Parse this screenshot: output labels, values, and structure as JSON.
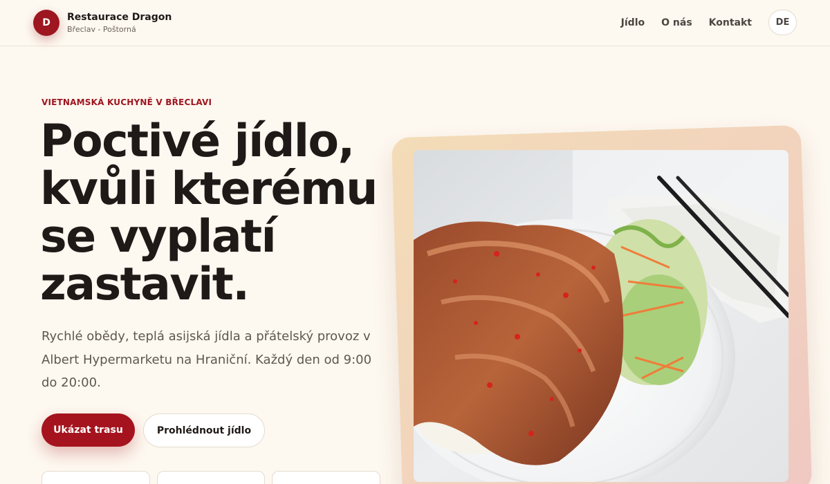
{
  "header": {
    "logo_letter": "D",
    "brand_name": "Restaurace Dragon",
    "brand_location": "Břeclav - Poštorná",
    "nav": [
      {
        "label": "Jídlo"
      },
      {
        "label": "O nás"
      },
      {
        "label": "Kontakt"
      }
    ],
    "language_button": "DE"
  },
  "hero": {
    "eyebrow": "VIETNAMSKÁ KUCHYNĚ V BŘECLAVI",
    "headline_lines": [
      "Poctivé jídlo,",
      "kvůli kterému",
      "se vyplatí",
      "zastavit."
    ],
    "lead": "Rychlé obědy, teplá asijská jídla a přátelský provoz v Albert Hypermarketu na Hraniční. Každý den od 9:00 do 20:00.",
    "primary_cta": "Ukázat trasu",
    "secondary_cta": "Prohlédnout jídlo"
  },
  "colors": {
    "accent": "#9d1620",
    "primary_button": "#a5141e",
    "background": "#fdf8f0",
    "text": "#1f1a17",
    "muted_text": "#5f5750"
  },
  "image": {
    "name": "chicken-rice-dish-photo"
  }
}
